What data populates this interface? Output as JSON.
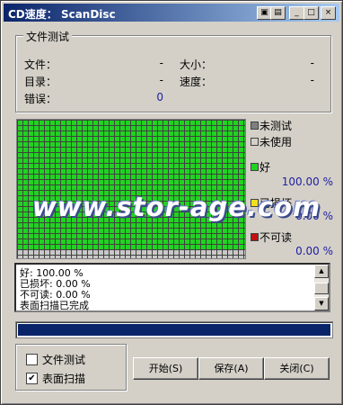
{
  "window": {
    "title": "CD速度：  ScanDisc",
    "btn_min": "_",
    "btn_max": "□",
    "btn_close": "×"
  },
  "file_test": {
    "group_label": "文件测试",
    "file_label": "文件：",
    "file_value": "-",
    "size_label": "大小：",
    "size_value": "-",
    "dir_label": "目录：",
    "dir_value": "-",
    "speed_label": "速度：",
    "speed_value": "-",
    "error_label": "错误：",
    "error_value": "0"
  },
  "surface": {
    "green_fraction": 0.92,
    "colors": {
      "good": "#21d321",
      "untested": "#c8c8c8",
      "grid": "#404040"
    }
  },
  "legend": {
    "untested": "未测试",
    "unused": "未使用",
    "good": "好",
    "good_value": "100.00 %",
    "damaged": "已损坏",
    "damaged_value": "0.00 %",
    "unreadable": "不可读",
    "unreadable_value": "0.00 %"
  },
  "log": [
    "好: 100.00 %",
    "已损坏: 0.00 %",
    "不可读: 0.00 %",
    "表面扫描已完成"
  ],
  "progress": {
    "value": 1.0
  },
  "options": {
    "file_test": {
      "label": "文件测试",
      "checked": false
    },
    "surface_scan": {
      "label": "表面扫描",
      "checked": true
    }
  },
  "buttons": {
    "start": "开始(S)",
    "save": "保存(A)",
    "close": "关闭(C)"
  },
  "watermark": "www.stor-age.com"
}
